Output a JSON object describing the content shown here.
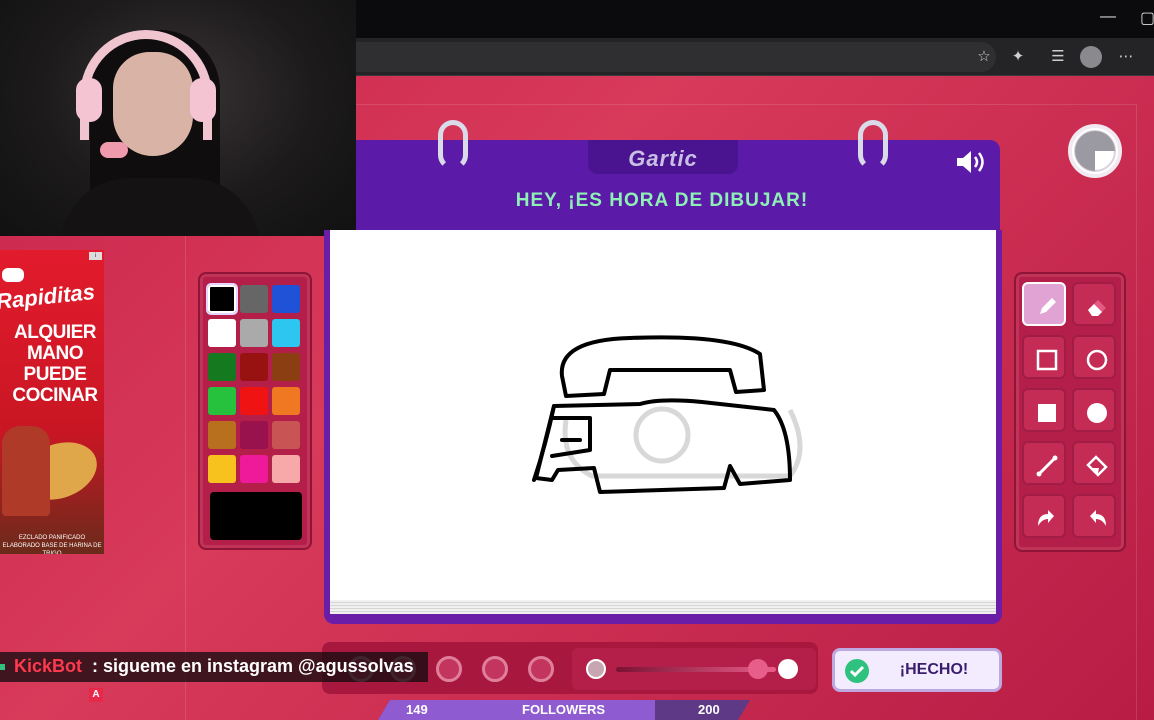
{
  "game": {
    "logo": "Gartic",
    "title": "HEY, ¡ES HORA DE DIBUJAR!",
    "done_label": "¡HECHO!"
  },
  "palette": {
    "colors": [
      "#000000",
      "#666666",
      "#1f52d6",
      "#ffffff",
      "#aaaaaa",
      "#2cc6f0",
      "#157a1f",
      "#991212",
      "#8a3e12",
      "#27c23d",
      "#f01313",
      "#f07822",
      "#b8701e",
      "#99114d",
      "#c95454",
      "#f7c21d",
      "#ef1a9a",
      "#f7a8a8"
    ],
    "selected_index": 0,
    "current_color": "#000000"
  },
  "tools": [
    "pencil-icon",
    "eraser-icon",
    "rectangle-outline-icon",
    "circle-outline-icon",
    "rectangle-fill-icon",
    "circle-fill-icon",
    "line-icon",
    "fill-bucket-icon",
    "undo-icon",
    "redo-icon"
  ],
  "chat": {
    "username": "KickBot",
    "message": ": sigueme en instagram @agussolvas",
    "badge": "A"
  },
  "followers": {
    "current": "149",
    "label": "FOLLOWERS",
    "goal": "200",
    "progress": 0.745
  },
  "ad": {
    "brand": "Rapiditas",
    "headline": "ALQUIER MANO PUEDE COCINAR",
    "fineprint": "EZCLADO PANIFICADO ELABORADO BASE DE HARINA DE TRIGO"
  },
  "colors": {
    "background": "#c8234a",
    "header": "#5b1ba8",
    "title_text": "#8ff0b6",
    "done_button": "#f3ecff"
  }
}
